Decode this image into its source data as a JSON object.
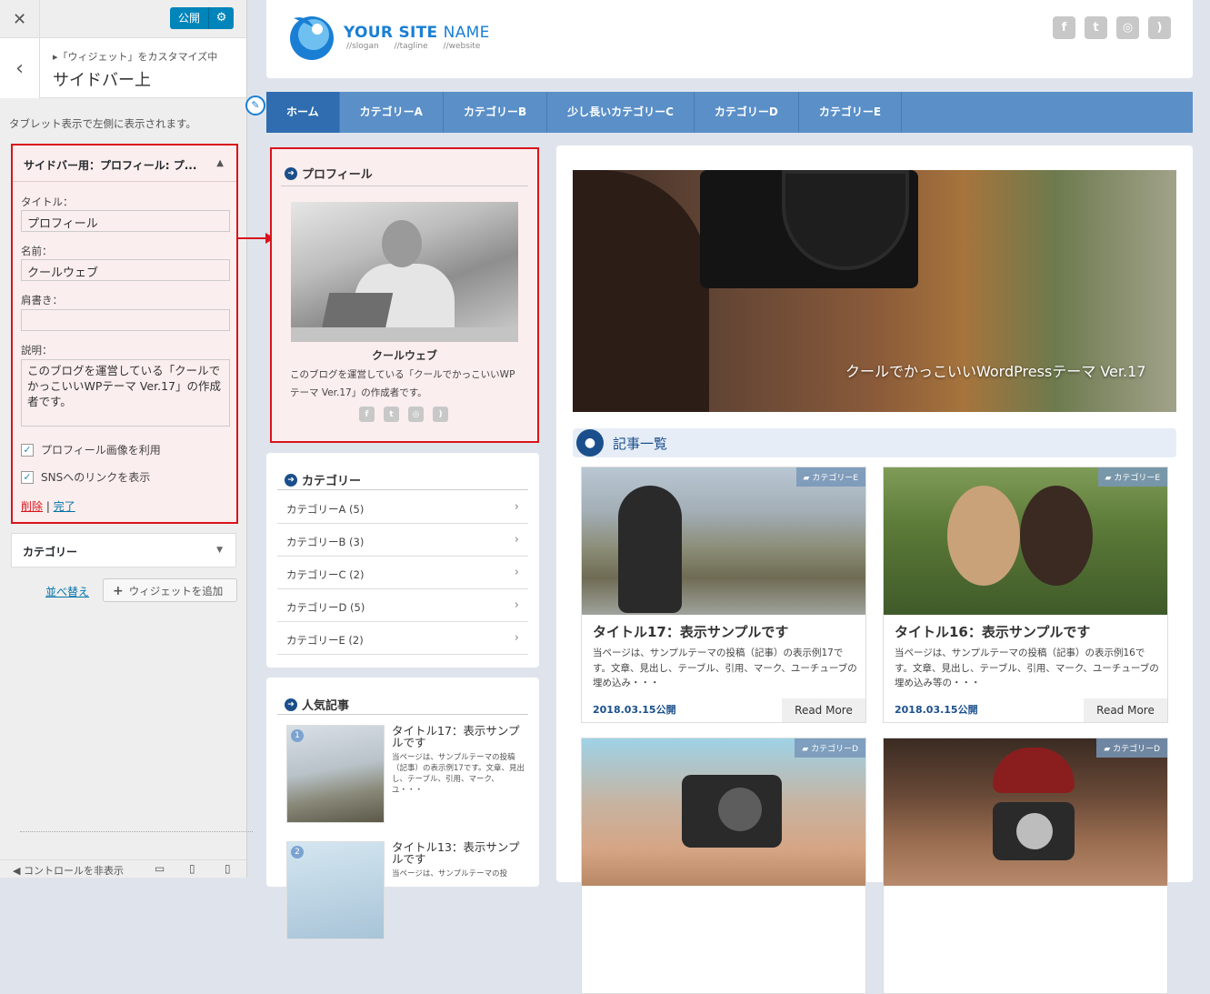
{
  "customizer": {
    "publish_label": "公開",
    "breadcrumb_sub": "▸「ウィジェット」をカスタマイズ中",
    "panel_title": "サイドバー上",
    "description": "タブレット表示で左側に表示されます。",
    "widget_header": "サイドバー用：プロフィール: プ...",
    "fields": {
      "title_label": "タイトル：",
      "title_value": "プロフィール",
      "name_label": "名前：",
      "name_value": "クールウェブ",
      "position_label": "肩書き：",
      "position_value": "",
      "desc_label": "説明：",
      "desc_value": "このブログを運営している「クールでかっこいいWPテーマ Ver.17」の作成者です。"
    },
    "checkboxes": [
      {
        "label": "プロフィール画像を利用",
        "checked": true
      },
      {
        "label": "SNSへのリンクを表示",
        "checked": true
      }
    ],
    "delete_label": "削除",
    "separator": "|",
    "done_label": "完了",
    "category_widget": "カテゴリー",
    "reorder_label": "並べ替え",
    "add_widget_label": "ウィジェットを追加",
    "hide_controls": "コントロールを非表示"
  },
  "site": {
    "name_bold": "YOUR SITE",
    "name_light": "NAME",
    "taglines": [
      "//slogan",
      "//tagline",
      "//website"
    ],
    "nav": [
      "ホーム",
      "カテゴリーA",
      "カテゴリーB",
      "少し長いカテゴリーC",
      "カテゴリーD",
      "カテゴリーE"
    ],
    "profile": {
      "title": "プロフィール",
      "name": "クールウェブ",
      "desc": "このブログを運営している「クールでかっこいいWPテーマ Ver.17」の作成者です。"
    },
    "categories": {
      "title": "カテゴリー",
      "items": [
        "カテゴリーA (5)",
        "カテゴリーB (3)",
        "カテゴリーC (2)",
        "カテゴリーD (5)",
        "カテゴリーE (2)"
      ]
    },
    "popular": {
      "title": "人気記事",
      "items": [
        {
          "num": "1",
          "title": "タイトル17：表示サンプルです",
          "desc": "当ページは、サンプルテーマの投稿（記事）の表示例17です。文章、見出し、テーブル、引用、マーク、ユ・・・"
        },
        {
          "num": "2",
          "title": "タイトル13：表示サンプルです",
          "desc": "当ページは、サンプルテーマの投"
        }
      ]
    },
    "hero_caption": "クールでかっこいいWordPressテーマ Ver.17",
    "section_title": "記事一覧",
    "read_more": "Read More",
    "posts": [
      {
        "badge": "カテゴリーE",
        "title": "タイトル17：表示サンプルです",
        "desc": "当ページは、サンプルテーマの投稿（記事）の表示例17です。文章、見出し、テーブル、引用、マーク、ユーチューブの埋め込み・・・",
        "date": "2018.03.15公開"
      },
      {
        "badge": "カテゴリーE",
        "title": "タイトル16：表示サンプルです",
        "desc": "当ページは、サンプルテーマの投稿（記事）の表示例16です。文章、見出し、テーブル、引用、マーク、ユーチューブの埋め込み等の・・・",
        "date": "2018.03.15公開"
      },
      {
        "badge": "カテゴリーD"
      },
      {
        "badge": "カテゴリーD"
      }
    ]
  },
  "colors": {
    "accent": "#0085ba",
    "highlight": "#d9141c",
    "nav": "#5a8fc8",
    "brand": "#1a4f8b"
  }
}
